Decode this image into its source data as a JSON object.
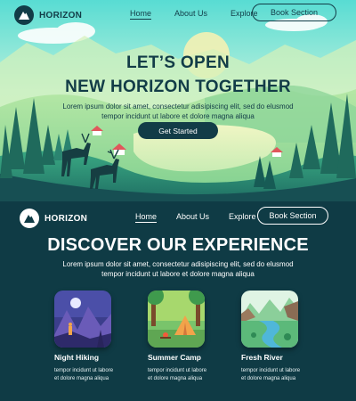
{
  "hero": {
    "nav": {
      "brand": "HORIZON",
      "links": [
        "Home",
        "About Us",
        "Explore"
      ],
      "book_label": "Book Section"
    },
    "title_line1": "LET’S OPEN",
    "title_line2": "NEW HORIZON TOGETHER",
    "subtitle_line1": "Lorem ipsum dolor sit amet, consectetur adisipiscing elit, sed do elusmod",
    "subtitle_line2": "tempor incidunt ut labore et dolore magna aliqua",
    "cta_label": "Get Started"
  },
  "section2": {
    "nav": {
      "brand": "HORIZON",
      "links": [
        "Home",
        "About Us",
        "Explore"
      ],
      "book_label": "Book Section"
    },
    "title": "DISCOVER OUR EXPERIENCE",
    "subtitle_line1": "Lorem ipsum dolor sit amet, consectetur adisipiscing elit, sed do elusmod",
    "subtitle_line2": "tempor incidunt ut labore et dolore magna aliqua",
    "cards": [
      {
        "title": "Night Hiking",
        "desc_line1": "tempor incidunt ut labore",
        "desc_line2": "et dolore magna aliqua"
      },
      {
        "title": "Summer Camp",
        "desc_line1": "tempor incidunt ut labore",
        "desc_line2": "et dolore magna aliqua"
      },
      {
        "title": "Fresh River",
        "desc_line1": "tempor incidunt ut labore",
        "desc_line2": "et dolore magna aliqua"
      }
    ]
  },
  "colors": {
    "dark_teal": "#123c47",
    "section_bg": "#0f3b45",
    "sky_top": "#5fe0d6",
    "sun": "#f4f1b4"
  },
  "icons": {
    "logo": "mountain-logo-icon"
  }
}
